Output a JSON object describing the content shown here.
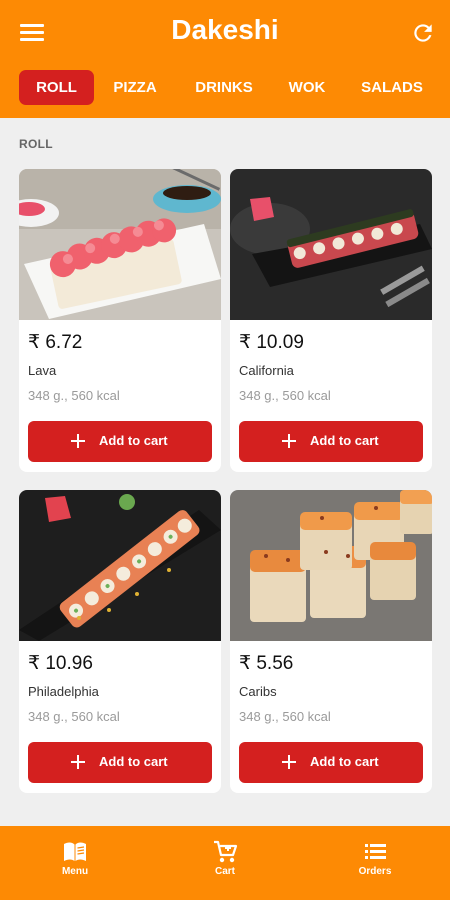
{
  "app": {
    "title": "Dakeshi"
  },
  "icons": {
    "menu": "hamburger-icon",
    "refresh": "refresh-icon",
    "plus": "plus-icon",
    "nav_menu": "book-icon",
    "nav_cart": "cart-icon",
    "nav_orders": "list-icon"
  },
  "colors": {
    "header": "#fd8a04",
    "accent": "#d4201f",
    "background": "#efefef"
  },
  "tabs": [
    {
      "label": "ROLL",
      "active": true
    },
    {
      "label": "PIZZA"
    },
    {
      "label": "DRINKS"
    },
    {
      "label": "WOK"
    },
    {
      "label": "SALADS"
    }
  ],
  "section": {
    "label": "ROLL"
  },
  "products": [
    {
      "price": "₹ 6.72",
      "name": "Lava",
      "meta": "348 g., 560 kcal",
      "button": "Add to cart"
    },
    {
      "price": "₹ 10.09",
      "name": "California",
      "meta": "348 g., 560 kcal",
      "button": "Add to cart"
    },
    {
      "price": "₹ 10.96",
      "name": "Philadelphia",
      "meta": "348 g., 560 kcal",
      "button": "Add to cart"
    },
    {
      "price": "₹ 5.56",
      "name": "Caribs",
      "meta": "348 g., 560 kcal",
      "button": "Add to cart"
    }
  ],
  "nav": [
    {
      "label": "Menu"
    },
    {
      "label": "Cart"
    },
    {
      "label": "Orders"
    }
  ]
}
